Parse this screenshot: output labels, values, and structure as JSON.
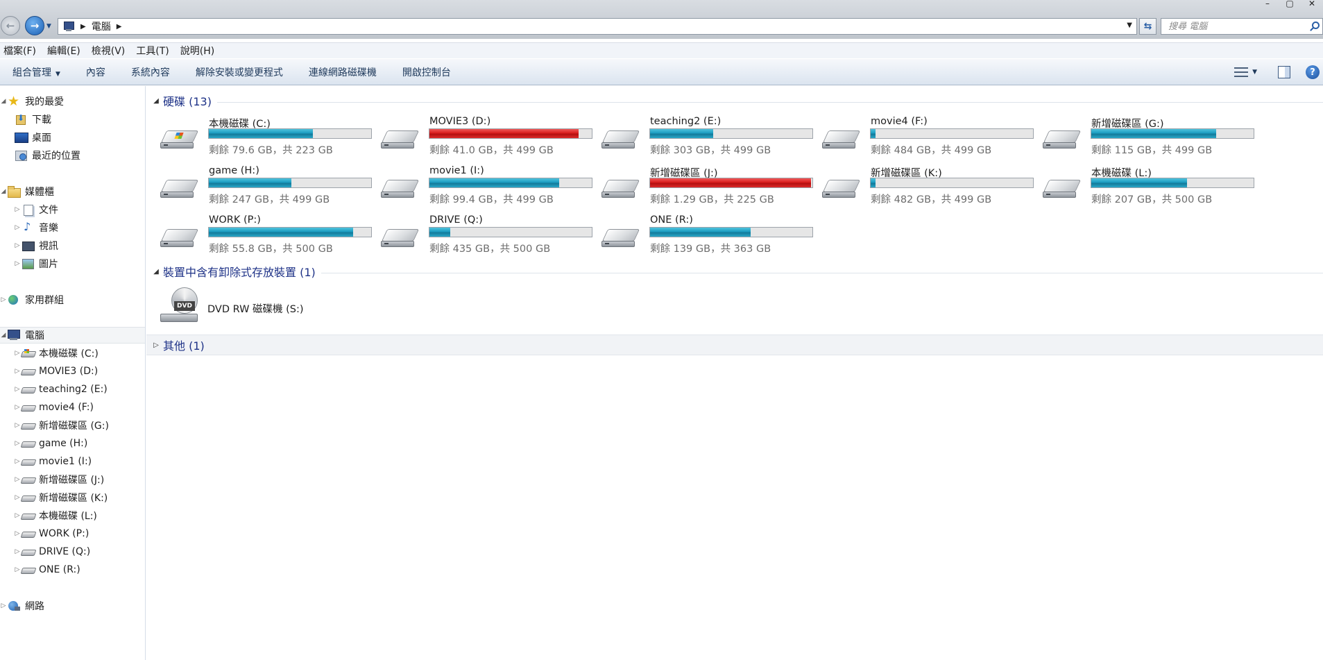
{
  "window": {
    "title_path": "電腦",
    "controls": [
      "–",
      "▢",
      "✕"
    ]
  },
  "address": {
    "crumb": "電腦",
    "search_placeholder": "搜尋 電腦"
  },
  "menu": [
    "檔案(F)",
    "編輯(E)",
    "檢視(V)",
    "工具(T)",
    "說明(H)"
  ],
  "toolbar": {
    "organize": "組合管理",
    "items": [
      "內容",
      "系統內容",
      "解除安裝或變更程式",
      "連線網路磁碟機",
      "開啟控制台"
    ]
  },
  "nav": {
    "favorites": {
      "label": "我的最愛",
      "items": [
        "下載",
        "桌面",
        "最近的位置"
      ]
    },
    "libraries": {
      "label": "媒體櫃",
      "items": [
        "文件",
        "音樂",
        "視訊",
        "圖片"
      ]
    },
    "homegroup": "家用群組",
    "computer": {
      "label": "電腦",
      "items": [
        "本機磁碟 (C:)",
        "MOVIE3 (D:)",
        "teaching2 (E:)",
        "movie4 (F:)",
        "新增磁碟區 (G:)",
        "game (H:)",
        "movie1 (I:)",
        "新增磁碟區 (J:)",
        "新增磁碟區 (K:)",
        "本機磁碟 (L:)",
        "WORK (P:)",
        "DRIVE (Q:)",
        "ONE (R:)"
      ]
    },
    "network": "網路"
  },
  "groups": {
    "hdd": "硬碟 (13)",
    "removable": "裝置中含有卸除式存放裝置 (1)",
    "other": "其他 (1)"
  },
  "drives": [
    {
      "name": "本機磁碟 (C:)",
      "free": "剩餘 79.6 GB，共 223 GB",
      "used_fraction": 0.64,
      "full": false,
      "system": true
    },
    {
      "name": "MOVIE3 (D:)",
      "free": "剩餘 41.0 GB，共 499 GB",
      "used_fraction": 0.92,
      "full": true
    },
    {
      "name": "teaching2 (E:)",
      "free": "剩餘 303 GB，共 499 GB",
      "used_fraction": 0.39,
      "full": false
    },
    {
      "name": "movie4 (F:)",
      "free": "剩餘 484 GB，共 499 GB",
      "used_fraction": 0.03,
      "full": false
    },
    {
      "name": "新增磁碟區 (G:)",
      "free": "剩餘 115 GB，共 499 GB",
      "used_fraction": 0.77,
      "full": false
    },
    {
      "name": "game (H:)",
      "free": "剩餘 247 GB，共 499 GB",
      "used_fraction": 0.51,
      "full": false
    },
    {
      "name": "movie1 (I:)",
      "free": "剩餘 99.4 GB，共 499 GB",
      "used_fraction": 0.8,
      "full": false
    },
    {
      "name": "新增磁碟區 (J:)",
      "free": "剩餘 1.29 GB，共 225 GB",
      "used_fraction": 0.99,
      "full": true
    },
    {
      "name": "新增磁碟區 (K:)",
      "free": "剩餘 482 GB，共 499 GB",
      "used_fraction": 0.03,
      "full": false
    },
    {
      "name": "本機磁碟 (L:)",
      "free": "剩餘 207 GB，共 500 GB",
      "used_fraction": 0.59,
      "full": false
    },
    {
      "name": "WORK (P:)",
      "free": "剩餘 55.8 GB，共 500 GB",
      "used_fraction": 0.89,
      "full": false
    },
    {
      "name": "DRIVE (Q:)",
      "free": "剩餘 435 GB，共 500 GB",
      "used_fraction": 0.13,
      "full": false
    },
    {
      "name": "ONE (R:)",
      "free": "剩餘 139 GB，共 363 GB",
      "used_fraction": 0.62,
      "full": false
    }
  ],
  "dvd": {
    "name": "DVD RW 磁碟機 (S:)",
    "icon_text": "DVD"
  }
}
